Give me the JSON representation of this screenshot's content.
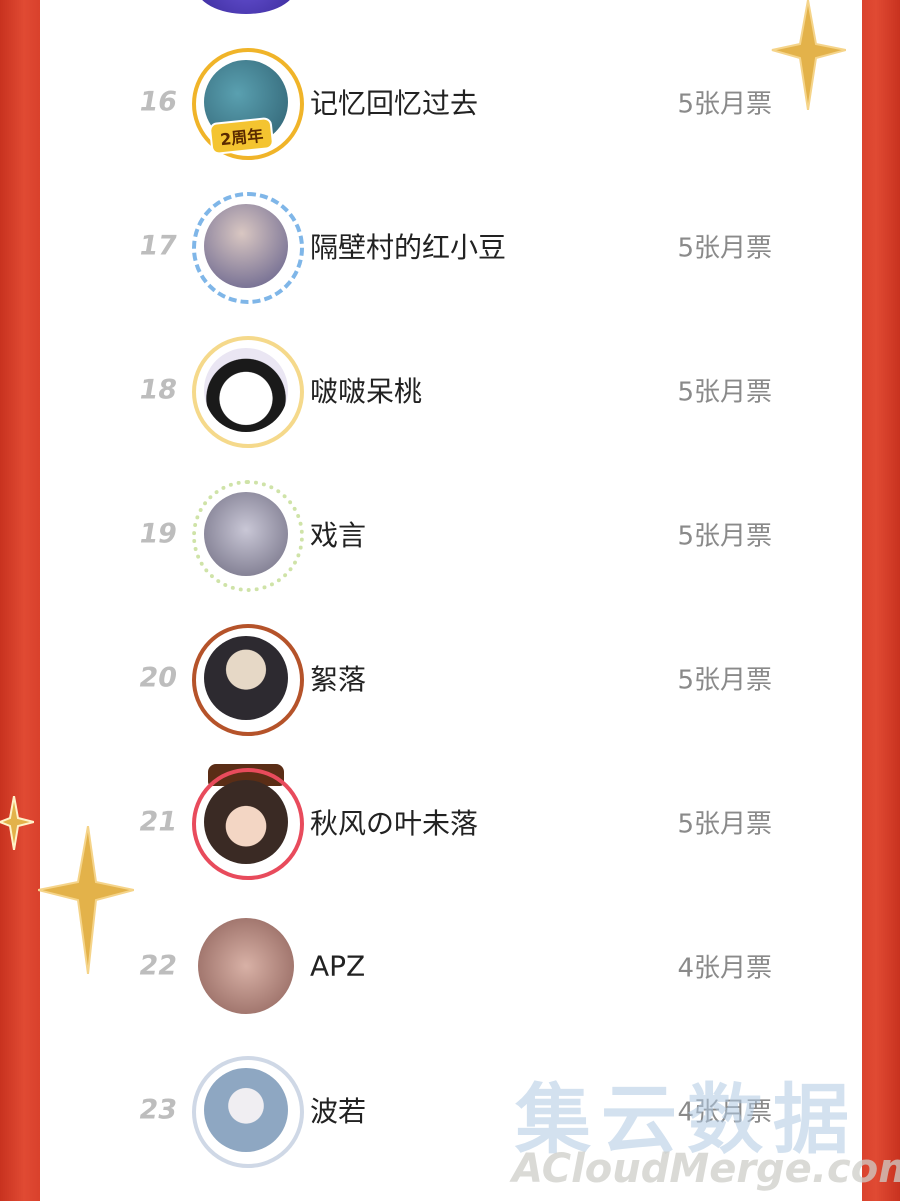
{
  "ranking": [
    {
      "rank": "16",
      "name": "记忆回忆过去",
      "votes": "5张月票",
      "badge": "2周年",
      "frame_color": "#f0b429",
      "avatar_color": "#3a7a8c"
    },
    {
      "rank": "17",
      "name": "隔壁村的红小豆",
      "votes": "5张月票",
      "frame_color": "#7fb6e8",
      "avatar_color": "#6d6a98"
    },
    {
      "rank": "18",
      "name": "啵啵呆桃",
      "votes": "5张月票",
      "frame_color": "#f5d98b",
      "avatar_color": "#eae6f3"
    },
    {
      "rank": "19",
      "name": "戏言",
      "votes": "5张月票",
      "frame_color": "#cfe3a8",
      "avatar_color": "#8d8a9e"
    },
    {
      "rank": "20",
      "name": "絮落",
      "votes": "5张月票",
      "frame_color": "#b5532a",
      "avatar_color": "#2d2a30"
    },
    {
      "rank": "21",
      "name": "秋风の叶未落",
      "votes": "5张月票",
      "frame_color": "#e84b5c",
      "avatar_color": "#3a2a24"
    },
    {
      "rank": "22",
      "name": "APZ",
      "votes": "4张月票",
      "frame_color": "#ffffff",
      "avatar_color": "#b98a84"
    },
    {
      "rank": "23",
      "name": "波若",
      "votes": "4张月票",
      "frame_color": "#cfd8e6",
      "avatar_color": "#8ea7c2"
    }
  ],
  "watermark": {
    "cn": "集云数据",
    "en": "ACloudMerge.com"
  },
  "colors": {
    "background_red": "#d8432f",
    "panel": "#ffffff",
    "rank_gray": "#bdbdbd",
    "vote_gray": "#8a8a8a",
    "sparkle_gold": "#e3b24a"
  }
}
